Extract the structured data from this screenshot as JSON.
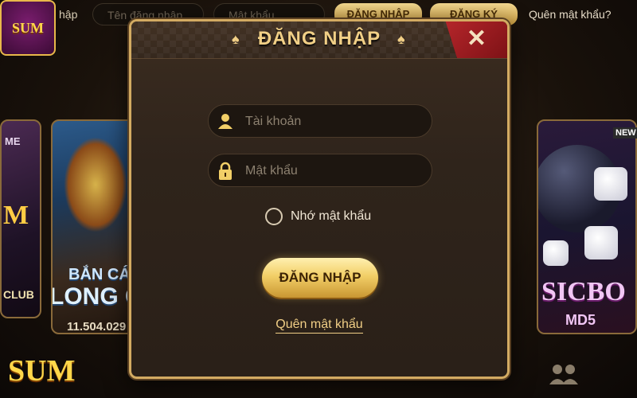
{
  "background": {
    "logo_text": "SUM",
    "top_partial_label": "hập",
    "top_username_placeholder": "Tên đăng nhập",
    "top_password_placeholder": "Mật khẩu",
    "top_login_button": "ĐĂNG NHẬP",
    "top_register_button": "ĐĂNG KÝ",
    "top_forgot_link": "Quên mật khẩu?",
    "card_left": {
      "line1": "ME",
      "line2": "M",
      "line3": "CLUB"
    },
    "card_long": {
      "line1": "BẮN CÁ",
      "line2": "LONG CUNG",
      "jackpot": "11.504.029"
    },
    "card_sicbo": {
      "line1": "SICBO",
      "line2": "MD5",
      "badge": "NEW"
    },
    "bottom_logo_text": "SUM"
  },
  "modal": {
    "title": "ĐĂNG NHẬP",
    "close_label": "✕",
    "username_placeholder": "Tài khoản",
    "password_placeholder": "Mật khẩu",
    "remember_label": "Nhớ mật khẩu",
    "remember_checked": false,
    "login_button": "ĐĂNG NHẬP",
    "forgot_link": "Quên mật khẩu"
  },
  "colors": {
    "gold": "#f1cf86",
    "close_red": "#b9272c",
    "panel": "#2f241b"
  },
  "icons": {
    "title_decor": "spade-icon",
    "username": "user-icon",
    "password": "lock-icon",
    "close": "close-icon",
    "people": "people-icon"
  }
}
